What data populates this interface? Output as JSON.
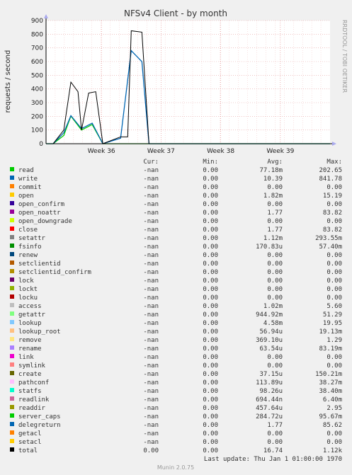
{
  "chart_data": {
    "type": "line",
    "title": "NFSv4 Client - by month",
    "ylabel": "requests / second",
    "xlabel": "",
    "ylim": [
      0,
      900
    ],
    "y_ticks": [
      "0",
      "100",
      "200",
      "300",
      "400",
      "500",
      "600",
      "700",
      "800",
      "900"
    ],
    "x_ticks": [
      "Week 36",
      "Week 37",
      "Week 38",
      "Week 39"
    ],
    "grid": true,
    "vendor_text": "RRDTOOL / TOBI OETIKER",
    "legend_headers": {
      "cur": "Cur:",
      "min": "Min:",
      "avg": "Avg:",
      "max": "Max:"
    },
    "series": [
      {
        "name": "read",
        "color": "#00cc00",
        "cur": "-nan",
        "min": "0.00",
        "avg": "77.18m",
        "max": "202.65",
        "values": [
          [
            0,
            0
          ],
          [
            0.2,
            0
          ],
          [
            0.5,
            60
          ],
          [
            0.7,
            202
          ],
          [
            1.0,
            100
          ],
          [
            1.3,
            140
          ],
          [
            1.6,
            0
          ],
          [
            2.1,
            0
          ],
          [
            2.4,
            0
          ],
          [
            2.7,
            0
          ],
          [
            8,
            0
          ]
        ]
      },
      {
        "name": "write",
        "color": "#0066b3",
        "cur": "-nan",
        "min": "0.00",
        "avg": "10.39",
        "max": "841.78",
        "values": [
          [
            0,
            0
          ],
          [
            0.2,
            0
          ],
          [
            0.5,
            80
          ],
          [
            0.7,
            205
          ],
          [
            1.0,
            110
          ],
          [
            1.3,
            150
          ],
          [
            1.6,
            0
          ],
          [
            2.1,
            40
          ],
          [
            2.4,
            680
          ],
          [
            2.7,
            600
          ],
          [
            2.9,
            0
          ],
          [
            8,
            0
          ]
        ]
      },
      {
        "name": "commit",
        "color": "#ff8000",
        "cur": "-nan",
        "min": "0.00",
        "avg": "0.00",
        "max": "0.00"
      },
      {
        "name": "open",
        "color": "#ffcc00",
        "cur": "-nan",
        "min": "0.00",
        "avg": "1.82m",
        "max": "15.19"
      },
      {
        "name": "open_confirm",
        "color": "#330099",
        "cur": "-nan",
        "min": "0.00",
        "avg": "0.00",
        "max": "0.00"
      },
      {
        "name": "open_noattr",
        "color": "#990099",
        "cur": "-nan",
        "min": "0.00",
        "avg": "1.77",
        "max": "83.82"
      },
      {
        "name": "open_downgrade",
        "color": "#ccff00",
        "cur": "-nan",
        "min": "0.00",
        "avg": "0.00",
        "max": "0.00"
      },
      {
        "name": "close",
        "color": "#ff0000",
        "cur": "-nan",
        "min": "0.00",
        "avg": "1.77",
        "max": "83.82"
      },
      {
        "name": "setattr",
        "color": "#808080",
        "cur": "-nan",
        "min": "0.00",
        "avg": "1.12m",
        "max": "293.55m"
      },
      {
        "name": "fsinfo",
        "color": "#008f00",
        "cur": "-nan",
        "min": "0.00",
        "avg": "170.83u",
        "max": "57.40m"
      },
      {
        "name": "renew",
        "color": "#00487d",
        "cur": "-nan",
        "min": "0.00",
        "avg": "0.00",
        "max": "0.00"
      },
      {
        "name": "setclientid",
        "color": "#b35a00",
        "cur": "-nan",
        "min": "0.00",
        "avg": "0.00",
        "max": "0.00"
      },
      {
        "name": "setclientid_confirm",
        "color": "#b38f00",
        "cur": "-nan",
        "min": "0.00",
        "avg": "0.00",
        "max": "0.00"
      },
      {
        "name": "lock",
        "color": "#6b006b",
        "cur": "-nan",
        "min": "0.00",
        "avg": "0.00",
        "max": "0.00"
      },
      {
        "name": "lockt",
        "color": "#8fb300",
        "cur": "-nan",
        "min": "0.00",
        "avg": "0.00",
        "max": "0.00"
      },
      {
        "name": "locku",
        "color": "#b30000",
        "cur": "-nan",
        "min": "0.00",
        "avg": "0.00",
        "max": "0.00"
      },
      {
        "name": "access",
        "color": "#bebebe",
        "cur": "-nan",
        "min": "0.00",
        "avg": "1.02m",
        "max": "5.60"
      },
      {
        "name": "getattr",
        "color": "#80ff80",
        "cur": "-nan",
        "min": "0.00",
        "avg": "944.92m",
        "max": "51.29"
      },
      {
        "name": "lookup",
        "color": "#80c9ff",
        "cur": "-nan",
        "min": "0.00",
        "avg": "4.58m",
        "max": "19.95"
      },
      {
        "name": "lookup_root",
        "color": "#ffc080",
        "cur": "-nan",
        "min": "0.00",
        "avg": "56.94u",
        "max": "19.13m"
      },
      {
        "name": "remove",
        "color": "#ffe680",
        "cur": "-nan",
        "min": "0.00",
        "avg": "369.10u",
        "max": "1.29"
      },
      {
        "name": "rename",
        "color": "#aa80ff",
        "cur": "-nan",
        "min": "0.00",
        "avg": "63.54u",
        "max": "83.19m"
      },
      {
        "name": "link",
        "color": "#ee00cc",
        "cur": "-nan",
        "min": "0.00",
        "avg": "0.00",
        "max": "0.00"
      },
      {
        "name": "symlink",
        "color": "#ff8080",
        "cur": "-nan",
        "min": "0.00",
        "avg": "0.00",
        "max": "0.00"
      },
      {
        "name": "create",
        "color": "#666600",
        "cur": "-nan",
        "min": "0.00",
        "avg": "37.15u",
        "max": "150.21m"
      },
      {
        "name": "pathconf",
        "color": "#ffbfff",
        "cur": "-nan",
        "min": "0.00",
        "avg": "113.89u",
        "max": "38.27m"
      },
      {
        "name": "statfs",
        "color": "#00ffcc",
        "cur": "-nan",
        "min": "0.00",
        "avg": "98.26u",
        "max": "38.40m"
      },
      {
        "name": "readlink",
        "color": "#cc6699",
        "cur": "-nan",
        "min": "0.00",
        "avg": "694.44n",
        "max": "6.40m"
      },
      {
        "name": "readdir",
        "color": "#999900",
        "cur": "-nan",
        "min": "0.00",
        "avg": "457.64u",
        "max": "2.95"
      },
      {
        "name": "server_caps",
        "color": "#00cc00",
        "cur": "-nan",
        "min": "0.00",
        "avg": "284.72u",
        "max": "95.67m"
      },
      {
        "name": "delegreturn",
        "color": "#0066b3",
        "cur": "-nan",
        "min": "0.00",
        "avg": "1.77",
        "max": "85.62"
      },
      {
        "name": "getacl",
        "color": "#ff8000",
        "cur": "-nan",
        "min": "0.00",
        "avg": "0.00",
        "max": "0.00"
      },
      {
        "name": "setacl",
        "color": "#ffcc00",
        "cur": "-nan",
        "min": "0.00",
        "avg": "0.00",
        "max": "0.00"
      },
      {
        "name": "total",
        "color": "#000000",
        "cur": "0.00",
        "min": "0.00",
        "avg": "16.74",
        "max": "1.12k",
        "values": [
          [
            0,
            0
          ],
          [
            0.2,
            0
          ],
          [
            0.5,
            100
          ],
          [
            0.7,
            450
          ],
          [
            0.9,
            380
          ],
          [
            1.0,
            100
          ],
          [
            1.2,
            370
          ],
          [
            1.4,
            380
          ],
          [
            1.6,
            0
          ],
          [
            2.1,
            50
          ],
          [
            2.3,
            50
          ],
          [
            2.4,
            825
          ],
          [
            2.7,
            815
          ],
          [
            2.9,
            0
          ],
          [
            8,
            0
          ]
        ]
      }
    ],
    "x_domain": [
      0,
      8
    ],
    "last_update": "Last update: Thu Jan  1 01:00:00 1970",
    "footer": "Munin 2.0.75"
  }
}
